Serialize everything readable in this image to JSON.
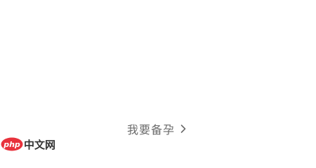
{
  "entry": {
    "label": "我要备孕",
    "chevron_icon": "chevron-right-icon"
  },
  "watermark": {
    "logo_text": "php",
    "site_text": "中文网",
    "logo_color": "#e8323c"
  },
  "colors": {
    "background": "#ffffff",
    "label_text": "#6b6b6b"
  }
}
